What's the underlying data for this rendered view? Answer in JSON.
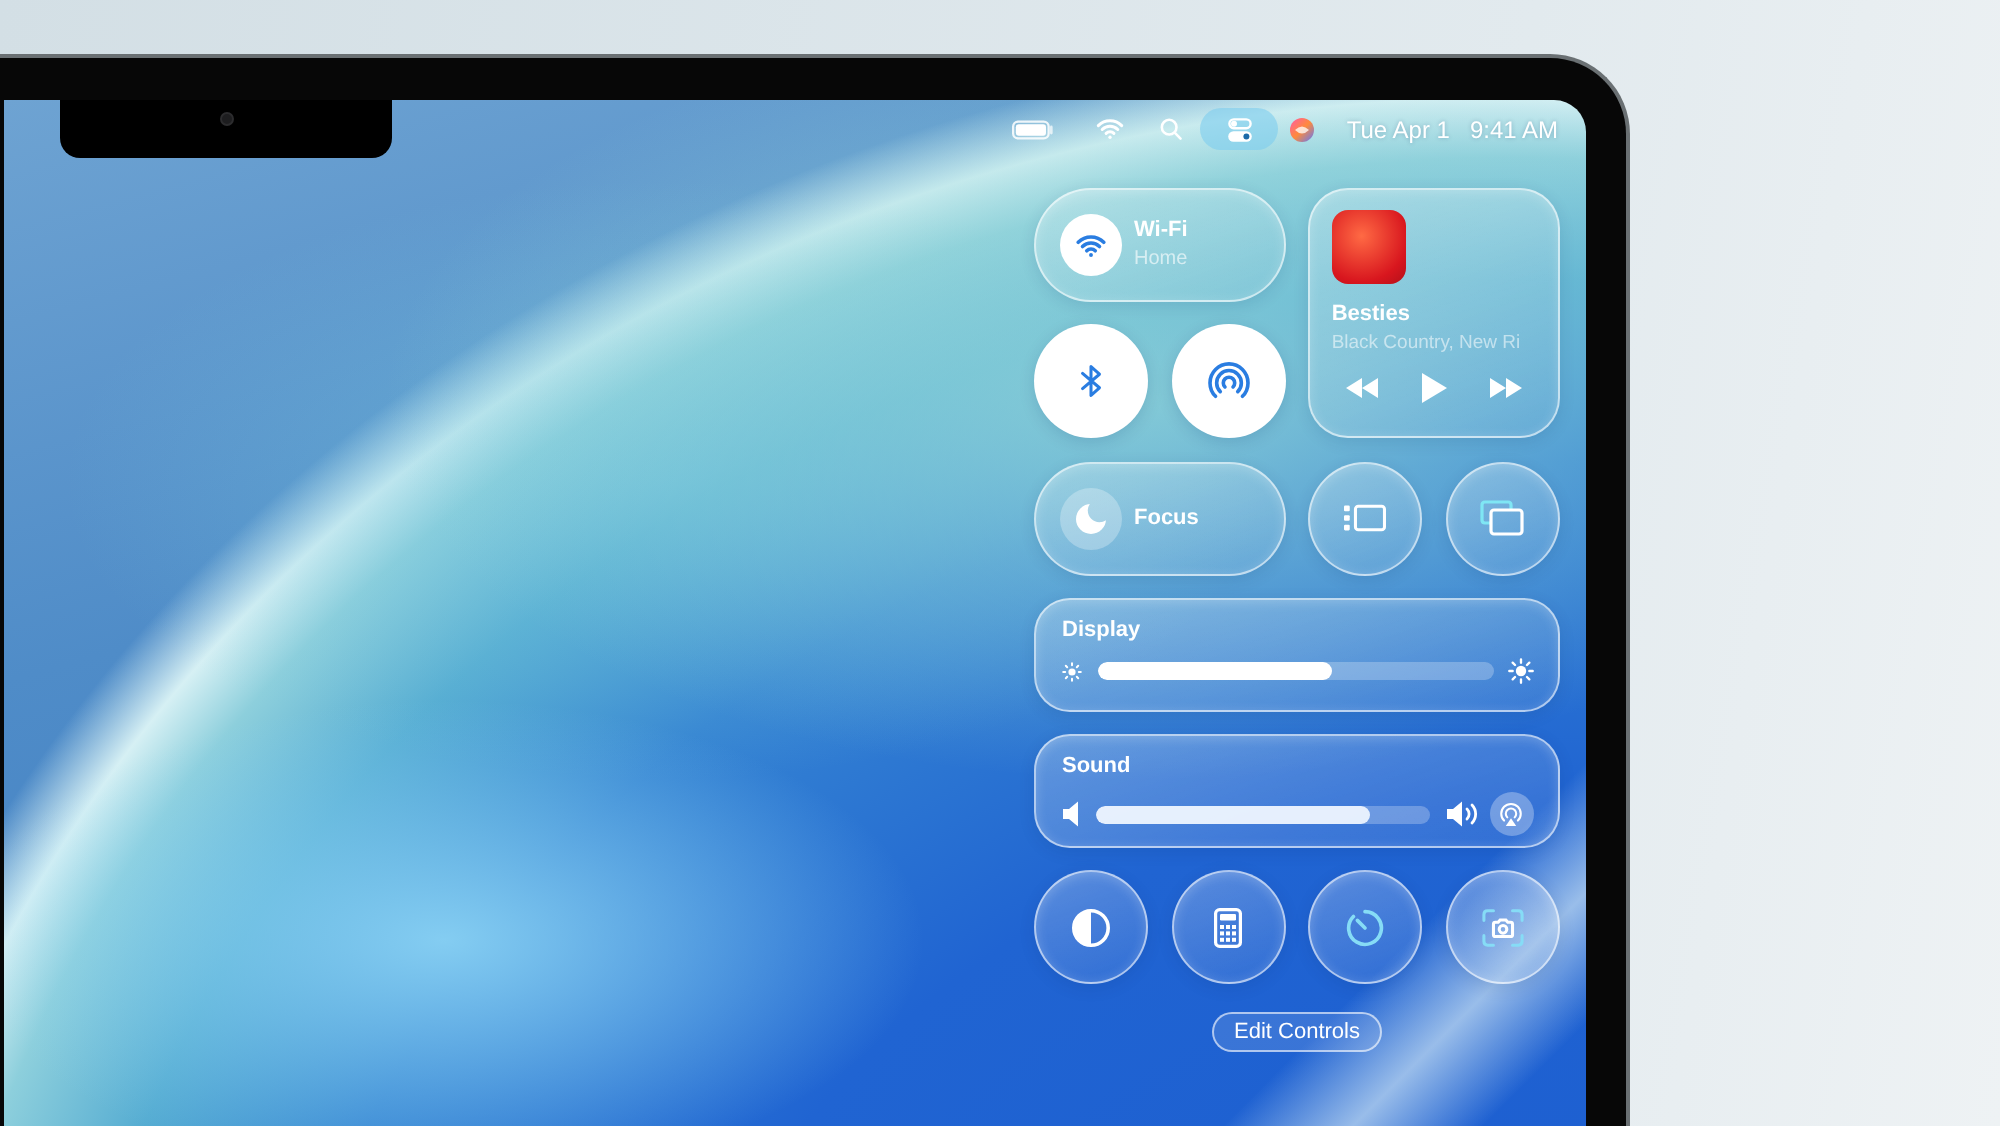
{
  "menu_bar": {
    "control_center_button": {
      "selected": true
    },
    "date": "Tue Apr 1",
    "time": "9:41 AM"
  },
  "control_center": {
    "wifi": {
      "label": "Wi-Fi",
      "network": "Home",
      "on": true
    },
    "now_playing": {
      "title": "Besties",
      "artist": "Black Country, New Ri"
    },
    "bluetooth": {
      "on": true
    },
    "airdrop": {
      "on": true
    },
    "focus": {
      "label": "Focus",
      "on": false
    },
    "display": {
      "label": "Display",
      "level": 0.59
    },
    "sound": {
      "label": "Sound",
      "level": 0.82
    },
    "edit_button": "Edit Controls"
  }
}
